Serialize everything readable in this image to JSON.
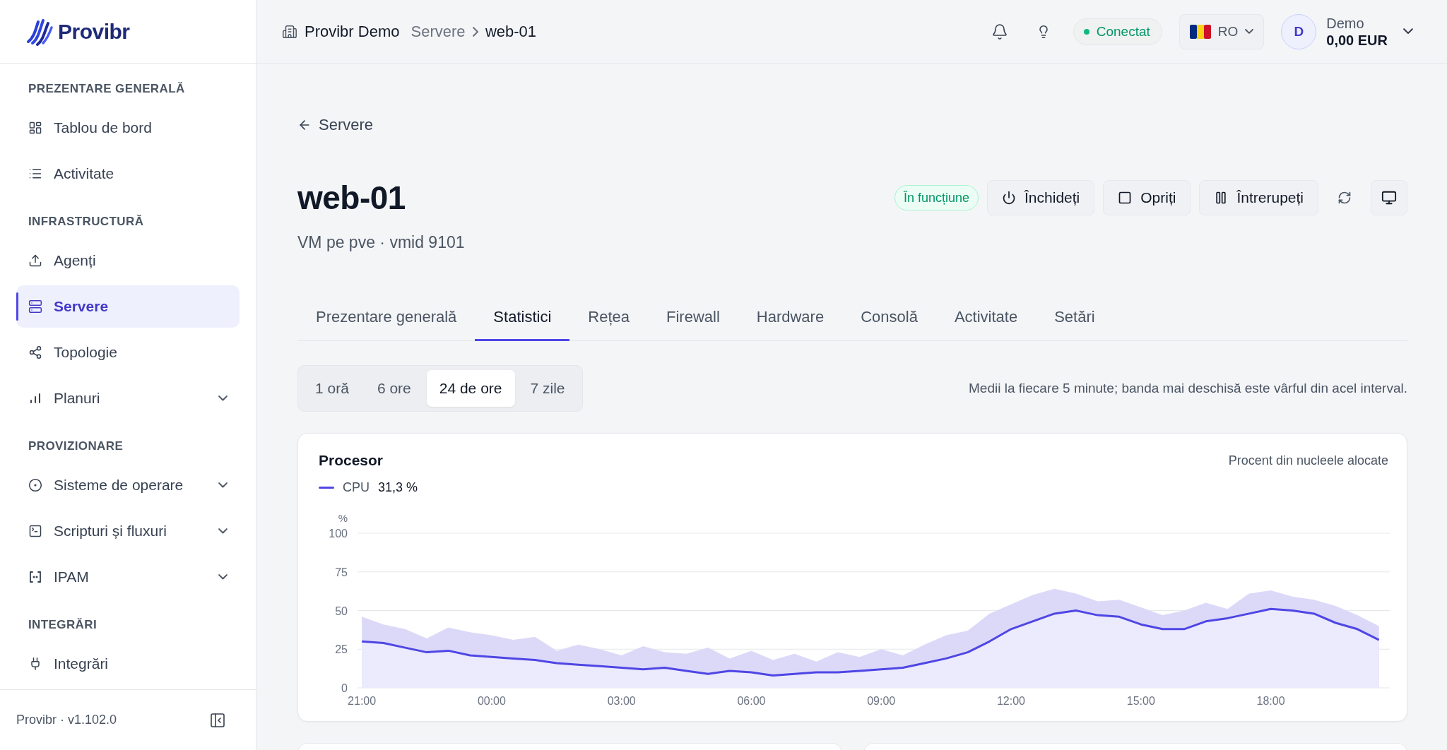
{
  "sidebar": {
    "logo_text": "Provibr",
    "sections": [
      {
        "title": "PREZENTARE GENERALĂ",
        "items": [
          {
            "label": "Tablou de bord",
            "selected": false,
            "expandable": false
          },
          {
            "label": "Activitate",
            "selected": false,
            "expandable": false
          }
        ]
      },
      {
        "title": "INFRASTRUCTURĂ",
        "items": [
          {
            "label": "Agenți",
            "selected": false,
            "expandable": false
          },
          {
            "label": "Servere",
            "selected": true,
            "expandable": false
          },
          {
            "label": "Topologie",
            "selected": false,
            "expandable": false
          },
          {
            "label": "Planuri",
            "selected": false,
            "expandable": true
          }
        ]
      },
      {
        "title": "PROVIZIONARE",
        "items": [
          {
            "label": "Sisteme de operare",
            "selected": false,
            "expandable": true
          },
          {
            "label": "Scripturi și fluxuri",
            "selected": false,
            "expandable": true
          },
          {
            "label": "IPAM",
            "selected": false,
            "expandable": true
          }
        ]
      },
      {
        "title": "INTEGRĂRI",
        "items": [
          {
            "label": "Integrări",
            "selected": false,
            "expandable": false
          }
        ]
      }
    ],
    "footer": "Provibr · v1.102.0"
  },
  "topbar": {
    "org": "Provibr Demo",
    "breadcrumb": [
      {
        "label": "Servere",
        "current": false
      },
      {
        "label": "web-01",
        "current": true
      }
    ],
    "connection": "Conectat",
    "language": "RO",
    "user": {
      "initial": "D",
      "name": "Demo",
      "balance": "0,00 EUR"
    }
  },
  "page": {
    "back_link": "Servere",
    "title": "web-01",
    "subtitle": "VM pe pve · vmid 9101",
    "status": "În funcțiune",
    "actions": [
      {
        "label": "Închideți"
      },
      {
        "label": "Opriți"
      },
      {
        "label": "Întrerupeți"
      }
    ],
    "tabs": [
      {
        "label": "Prezentare generală",
        "selected": false
      },
      {
        "label": "Statistici",
        "selected": true
      },
      {
        "label": "Rețea",
        "selected": false
      },
      {
        "label": "Firewall",
        "selected": false
      },
      {
        "label": "Hardware",
        "selected": false
      },
      {
        "label": "Consolă",
        "selected": false
      },
      {
        "label": "Activitate",
        "selected": false
      },
      {
        "label": "Setări",
        "selected": false
      }
    ],
    "ranges": [
      {
        "label": "1 oră",
        "selected": false
      },
      {
        "label": "6 ore",
        "selected": false
      },
      {
        "label": "24 de ore",
        "selected": true
      },
      {
        "label": "7 zile",
        "selected": false
      }
    ],
    "range_note": "Medii la fiecare 5 minute; banda mai deschisă este vârful din acel interval.",
    "cpu_card": {
      "title": "Procesor",
      "subtitle": "Procent din nucleele alocate",
      "legend_value": "31,3 %",
      "chart_data": {
        "type": "area",
        "ylabel": "%",
        "grid": true,
        "categories": [
          "21:00",
          null,
          null,
          null,
          null,
          null,
          "00:00",
          null,
          null,
          null,
          null,
          null,
          "03:00",
          null,
          null,
          null,
          null,
          null,
          "06:00",
          null,
          null,
          null,
          null,
          null,
          "09:00",
          null,
          null,
          null,
          null,
          null,
          "12:00",
          null,
          null,
          null,
          null,
          null,
          "15:00",
          null,
          null,
          null,
          null,
          null,
          "18:00",
          null,
          null,
          null,
          null,
          null
        ],
        "series": [
          {
            "name": "CPU",
            "color": "#4f46e5",
            "values": [
              30,
              29,
              26,
              23,
              24,
              21,
              20,
              19,
              18,
              16,
              15,
              14,
              13,
              12,
              13,
              11,
              9,
              11,
              10,
              8,
              9,
              10,
              10,
              11,
              12,
              13,
              16,
              19,
              23,
              30,
              38,
              43,
              48,
              50,
              47,
              46,
              41,
              38,
              38,
              43,
              45,
              48,
              51,
              50,
              48,
              42,
              38,
              31
            ]
          },
          {
            "color": "#dcd9f8",
            "values": [
              46,
              41,
              38,
              32,
              39,
              36,
              34,
              31,
              33,
              24,
              28,
              25,
              21,
              27,
              23,
              22,
              26,
              19,
              24,
              18,
              22,
              17,
              23,
              20,
              25,
              21,
              28,
              34,
              37,
              48,
              54,
              60,
              64,
              61,
              56,
              57,
              52,
              47,
              50,
              55,
              51,
              61,
              63,
              59,
              57,
              53,
              47,
              40
            ]
          }
        ],
        "ylim": [
          0,
          100
        ],
        "yticks": [
          0,
          25,
          50,
          75,
          100
        ]
      }
    }
  }
}
